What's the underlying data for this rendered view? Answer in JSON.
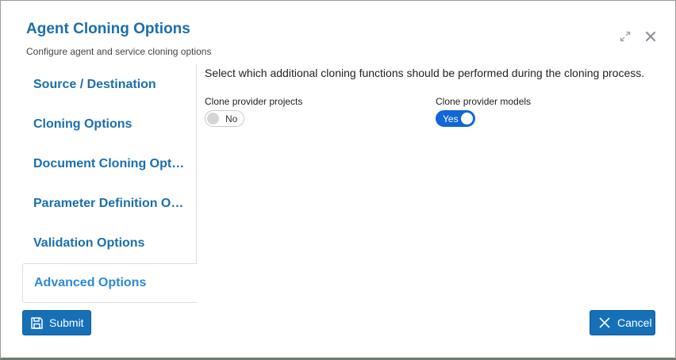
{
  "dialog": {
    "title": "Agent Cloning Options",
    "subtitle": "Configure agent and service cloning options",
    "icons": {
      "expand": "expand-icon",
      "close": "close-icon"
    }
  },
  "sidebar": {
    "items": [
      {
        "label": "Source / Destination",
        "active": false
      },
      {
        "label": "Cloning Options",
        "active": false
      },
      {
        "label": "Document Cloning Options",
        "active": false
      },
      {
        "label": "Parameter Definition Options",
        "active": false
      },
      {
        "label": "Validation Options",
        "active": false
      },
      {
        "label": "Advanced Options",
        "active": true
      }
    ]
  },
  "main": {
    "description": "Select which additional cloning functions should be performed during the cloning process.",
    "fields": [
      {
        "label": "Clone provider projects",
        "value": "No",
        "checked": false
      },
      {
        "label": "Clone provider models",
        "value": "Yes",
        "checked": true
      }
    ]
  },
  "footer": {
    "submit_label": "Submit",
    "cancel_label": "Cancel",
    "icons": {
      "submit": "save-icon",
      "cancel": "x-icon"
    }
  },
  "colors": {
    "title": "#1a6fae",
    "sidebar_text": "#1a6fae",
    "sidebar_active_text": "#2a8ad8",
    "button_bg": "#1670b8",
    "toggle_on": "#0f67d8"
  }
}
